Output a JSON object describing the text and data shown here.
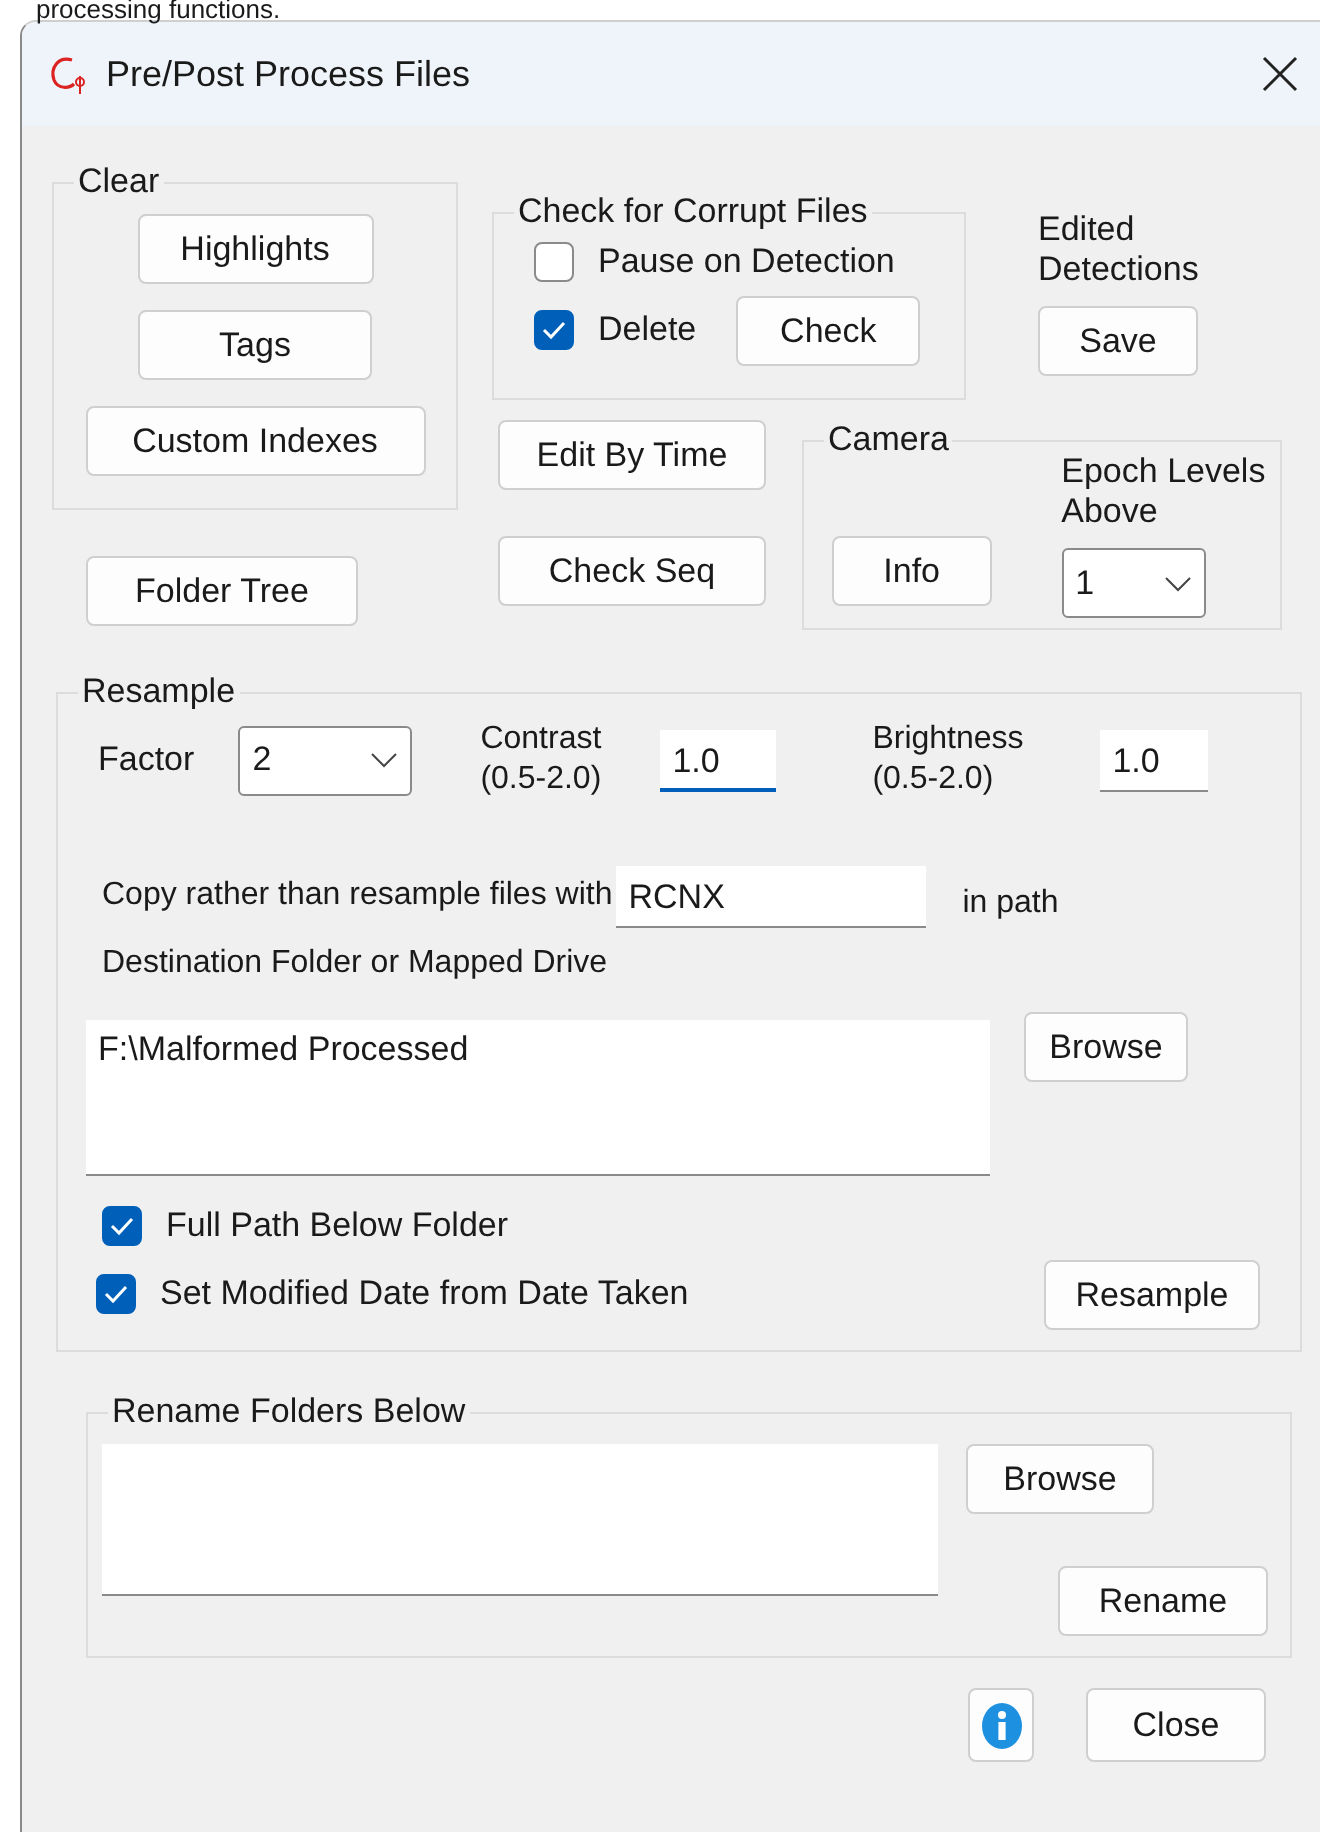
{
  "caption": "processing functions.",
  "window": {
    "title": "Pre/Post Process Files"
  },
  "clear": {
    "label": "Clear",
    "buttons": [
      "Highlights",
      "Tags",
      "Custom Indexes"
    ]
  },
  "corrupt": {
    "label": "Check for Corrupt Files",
    "options": [
      {
        "label": "Pause on Detection",
        "checked": false
      },
      {
        "label": "Delete",
        "checked": true
      }
    ],
    "button": "Check"
  },
  "edited": {
    "label": "Edited Detections",
    "button": "Save"
  },
  "folder_tree": "Folder Tree",
  "edit_by_time": "Edit By Time",
  "check_seq": "Check Seq",
  "camera": {
    "label": "Camera",
    "button": "Info",
    "epoch_label": "Epoch Levels Above",
    "epoch_value": "1"
  },
  "resample": {
    "label": "Resample",
    "factor_label": "Factor",
    "factor_value": "2",
    "contrast_label": "Contrast (0.5-2.0)",
    "contrast_value": "1.0",
    "contrast_focused": true,
    "brightness_label": "Brightness (0.5-2.0)",
    "brightness_value": "1.0",
    "copy_label": "Copy rather than resample files with",
    "copy_value": "RCNX",
    "copy_suffix": "in path",
    "dest_label": "Destination Folder or Mapped Drive",
    "dest_value": "F:\\Malformed Processed",
    "browse": "Browse",
    "options": [
      {
        "label": "Full Path Below Folder",
        "checked": true
      },
      {
        "label": "Set Modified Date from Date Taken",
        "checked": true
      }
    ],
    "button": "Resample"
  },
  "rename": {
    "label": "Rename Folders Below",
    "browse": "Browse",
    "button": "Rename"
  },
  "footer": {
    "close": "Close"
  }
}
